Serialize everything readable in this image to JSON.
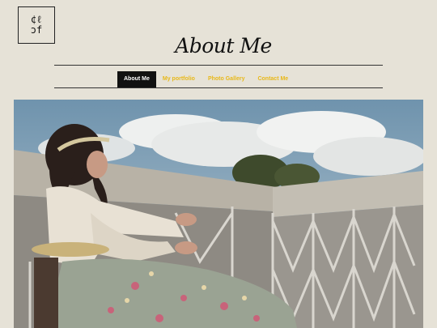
{
  "logo": {
    "line1": "¢ℓ",
    "line2": "ɔf"
  },
  "page_title": "About Me",
  "nav": {
    "items": [
      {
        "label": "About Me",
        "active": true
      },
      {
        "label": "My portfolio",
        "active": false
      },
      {
        "label": "Photo Gallery",
        "active": false
      },
      {
        "label": "Contact Me",
        "active": false
      }
    ]
  },
  "colors": {
    "background": "#e6e2d7",
    "nav_accent": "#e8b81a",
    "nav_active_bg": "#111111"
  }
}
